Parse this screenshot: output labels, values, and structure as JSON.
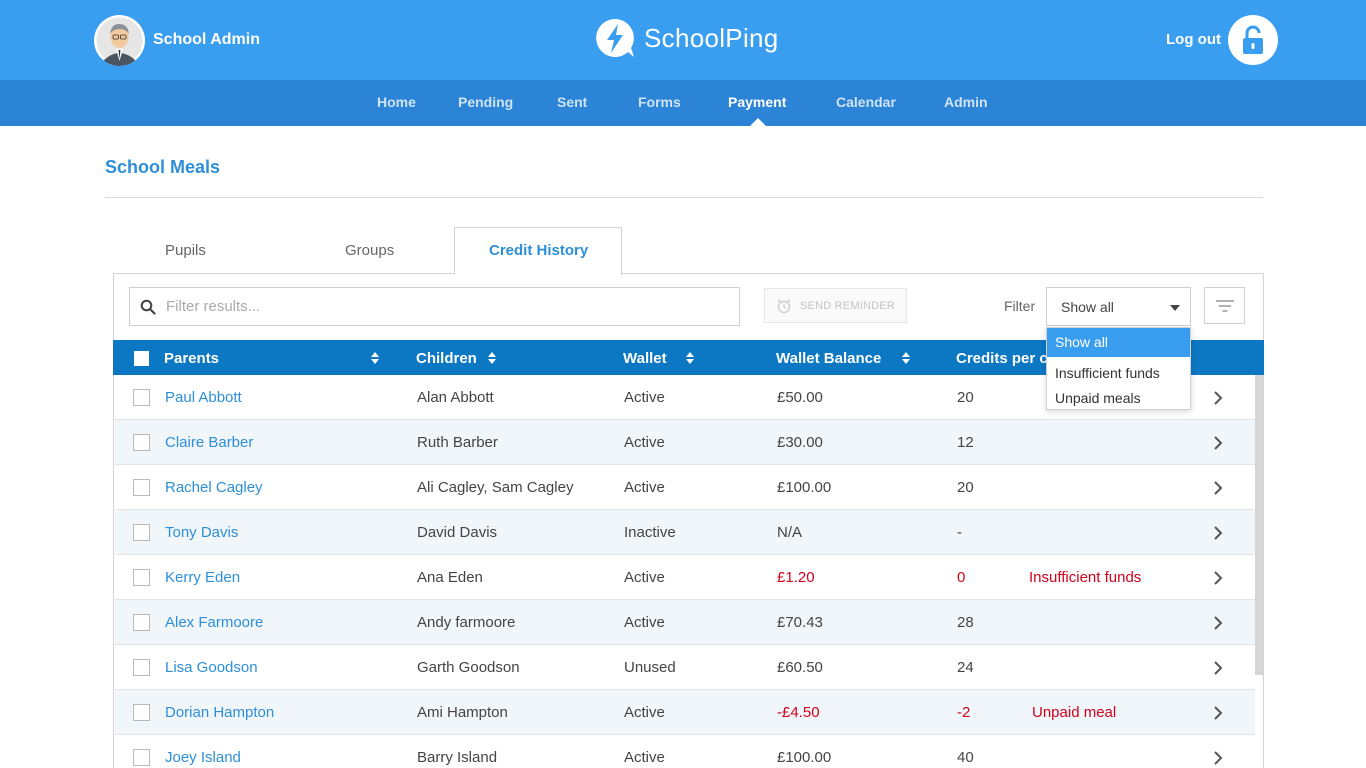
{
  "header": {
    "user_name": "School Admin",
    "brand_name": "SchoolPing",
    "logout_label": "Log out",
    "colors": {
      "topbar": "#3a9ef0",
      "navbar": "#2b84d6",
      "table_header": "#0c77c2",
      "accent": "#2e8fd9",
      "alert": "#d0021b"
    }
  },
  "nav": {
    "items": [
      {
        "label": "Home"
      },
      {
        "label": "Pending"
      },
      {
        "label": "Sent"
      },
      {
        "label": "Forms"
      },
      {
        "label": "Payment"
      },
      {
        "label": "Calendar"
      },
      {
        "label": "Admin"
      }
    ],
    "active": "Payment"
  },
  "page": {
    "title": "School Meals"
  },
  "tabs": [
    {
      "label": "Pupils"
    },
    {
      "label": "Groups"
    },
    {
      "label": "Credit History"
    }
  ],
  "toolbar": {
    "search_placeholder": "Filter results...",
    "send_reminder_label": "SEND REMINDER",
    "filter_label": "Filter",
    "filter_value": "Show all"
  },
  "filter_options": [
    "Show all",
    "Insufficient funds",
    "Unpaid meals"
  ],
  "table": {
    "columns": [
      "Parents",
      "Children",
      "Wallet",
      "Wallet Balance",
      "Credits per c"
    ],
    "rows": [
      {
        "parent": "Paul Abbott",
        "children": "Alan Abbott",
        "wallet": "Active",
        "balance": "£50.00",
        "credits": "20",
        "status": ""
      },
      {
        "parent": "Claire Barber",
        "children": "Ruth Barber",
        "wallet": "Active",
        "balance": "£30.00",
        "credits": "12",
        "status": ""
      },
      {
        "parent": "Rachel Cagley",
        "children": "Ali Cagley, Sam Cagley",
        "wallet": "Active",
        "balance": "£100.00",
        "credits": "20",
        "status": ""
      },
      {
        "parent": "Tony Davis",
        "children": "David Davis",
        "wallet": "Inactive",
        "balance": "N/A",
        "credits": "-",
        "status": ""
      },
      {
        "parent": "Kerry Eden",
        "children": "Ana Eden",
        "wallet": "Active",
        "balance": "£1.20",
        "credits": "0",
        "status": "Insufficient funds"
      },
      {
        "parent": "Alex Farmoore",
        "children": "Andy farmoore",
        "wallet": "Active",
        "balance": "£70.43",
        "credits": "28",
        "status": ""
      },
      {
        "parent": "Lisa Goodson",
        "children": "Garth Goodson",
        "wallet": "Unused",
        "balance": "£60.50",
        "credits": "24",
        "status": ""
      },
      {
        "parent": "Dorian Hampton",
        "children": "Ami Hampton",
        "wallet": "Active",
        "balance": "-£4.50",
        "credits": "-2",
        "status": "Unpaid meal"
      },
      {
        "parent": "Joey Island",
        "children": "Barry Island",
        "wallet": "Active",
        "balance": "£100.00",
        "credits": "40",
        "status": ""
      }
    ]
  }
}
